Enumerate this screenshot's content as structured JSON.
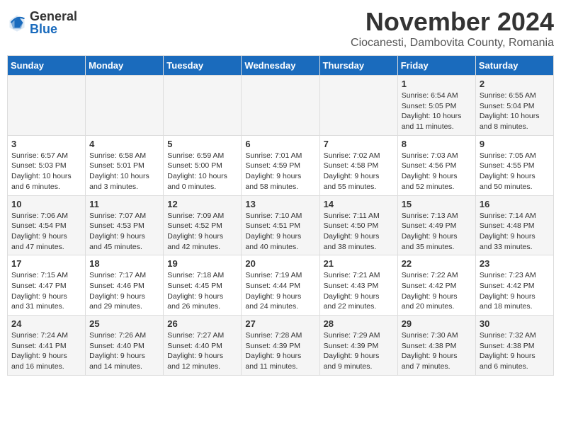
{
  "logo": {
    "general": "General",
    "blue": "Blue"
  },
  "title": {
    "month": "November 2024",
    "location": "Ciocanesti, Dambovita County, Romania"
  },
  "weekdays": [
    "Sunday",
    "Monday",
    "Tuesday",
    "Wednesday",
    "Thursday",
    "Friday",
    "Saturday"
  ],
  "weeks": [
    [
      {
        "day": "",
        "sunrise": "",
        "sunset": "",
        "daylight": ""
      },
      {
        "day": "",
        "sunrise": "",
        "sunset": "",
        "daylight": ""
      },
      {
        "day": "",
        "sunrise": "",
        "sunset": "",
        "daylight": ""
      },
      {
        "day": "",
        "sunrise": "",
        "sunset": "",
        "daylight": ""
      },
      {
        "day": "",
        "sunrise": "",
        "sunset": "",
        "daylight": ""
      },
      {
        "day": "1",
        "sunrise": "Sunrise: 6:54 AM",
        "sunset": "Sunset: 5:05 PM",
        "daylight": "Daylight: 10 hours and 11 minutes."
      },
      {
        "day": "2",
        "sunrise": "Sunrise: 6:55 AM",
        "sunset": "Sunset: 5:04 PM",
        "daylight": "Daylight: 10 hours and 8 minutes."
      }
    ],
    [
      {
        "day": "3",
        "sunrise": "Sunrise: 6:57 AM",
        "sunset": "Sunset: 5:03 PM",
        "daylight": "Daylight: 10 hours and 6 minutes."
      },
      {
        "day": "4",
        "sunrise": "Sunrise: 6:58 AM",
        "sunset": "Sunset: 5:01 PM",
        "daylight": "Daylight: 10 hours and 3 minutes."
      },
      {
        "day": "5",
        "sunrise": "Sunrise: 6:59 AM",
        "sunset": "Sunset: 5:00 PM",
        "daylight": "Daylight: 10 hours and 0 minutes."
      },
      {
        "day": "6",
        "sunrise": "Sunrise: 7:01 AM",
        "sunset": "Sunset: 4:59 PM",
        "daylight": "Daylight: 9 hours and 58 minutes."
      },
      {
        "day": "7",
        "sunrise": "Sunrise: 7:02 AM",
        "sunset": "Sunset: 4:58 PM",
        "daylight": "Daylight: 9 hours and 55 minutes."
      },
      {
        "day": "8",
        "sunrise": "Sunrise: 7:03 AM",
        "sunset": "Sunset: 4:56 PM",
        "daylight": "Daylight: 9 hours and 52 minutes."
      },
      {
        "day": "9",
        "sunrise": "Sunrise: 7:05 AM",
        "sunset": "Sunset: 4:55 PM",
        "daylight": "Daylight: 9 hours and 50 minutes."
      }
    ],
    [
      {
        "day": "10",
        "sunrise": "Sunrise: 7:06 AM",
        "sunset": "Sunset: 4:54 PM",
        "daylight": "Daylight: 9 hours and 47 minutes."
      },
      {
        "day": "11",
        "sunrise": "Sunrise: 7:07 AM",
        "sunset": "Sunset: 4:53 PM",
        "daylight": "Daylight: 9 hours and 45 minutes."
      },
      {
        "day": "12",
        "sunrise": "Sunrise: 7:09 AM",
        "sunset": "Sunset: 4:52 PM",
        "daylight": "Daylight: 9 hours and 42 minutes."
      },
      {
        "day": "13",
        "sunrise": "Sunrise: 7:10 AM",
        "sunset": "Sunset: 4:51 PM",
        "daylight": "Daylight: 9 hours and 40 minutes."
      },
      {
        "day": "14",
        "sunrise": "Sunrise: 7:11 AM",
        "sunset": "Sunset: 4:50 PM",
        "daylight": "Daylight: 9 hours and 38 minutes."
      },
      {
        "day": "15",
        "sunrise": "Sunrise: 7:13 AM",
        "sunset": "Sunset: 4:49 PM",
        "daylight": "Daylight: 9 hours and 35 minutes."
      },
      {
        "day": "16",
        "sunrise": "Sunrise: 7:14 AM",
        "sunset": "Sunset: 4:48 PM",
        "daylight": "Daylight: 9 hours and 33 minutes."
      }
    ],
    [
      {
        "day": "17",
        "sunrise": "Sunrise: 7:15 AM",
        "sunset": "Sunset: 4:47 PM",
        "daylight": "Daylight: 9 hours and 31 minutes."
      },
      {
        "day": "18",
        "sunrise": "Sunrise: 7:17 AM",
        "sunset": "Sunset: 4:46 PM",
        "daylight": "Daylight: 9 hours and 29 minutes."
      },
      {
        "day": "19",
        "sunrise": "Sunrise: 7:18 AM",
        "sunset": "Sunset: 4:45 PM",
        "daylight": "Daylight: 9 hours and 26 minutes."
      },
      {
        "day": "20",
        "sunrise": "Sunrise: 7:19 AM",
        "sunset": "Sunset: 4:44 PM",
        "daylight": "Daylight: 9 hours and 24 minutes."
      },
      {
        "day": "21",
        "sunrise": "Sunrise: 7:21 AM",
        "sunset": "Sunset: 4:43 PM",
        "daylight": "Daylight: 9 hours and 22 minutes."
      },
      {
        "day": "22",
        "sunrise": "Sunrise: 7:22 AM",
        "sunset": "Sunset: 4:42 PM",
        "daylight": "Daylight: 9 hours and 20 minutes."
      },
      {
        "day": "23",
        "sunrise": "Sunrise: 7:23 AM",
        "sunset": "Sunset: 4:42 PM",
        "daylight": "Daylight: 9 hours and 18 minutes."
      }
    ],
    [
      {
        "day": "24",
        "sunrise": "Sunrise: 7:24 AM",
        "sunset": "Sunset: 4:41 PM",
        "daylight": "Daylight: 9 hours and 16 minutes."
      },
      {
        "day": "25",
        "sunrise": "Sunrise: 7:26 AM",
        "sunset": "Sunset: 4:40 PM",
        "daylight": "Daylight: 9 hours and 14 minutes."
      },
      {
        "day": "26",
        "sunrise": "Sunrise: 7:27 AM",
        "sunset": "Sunset: 4:40 PM",
        "daylight": "Daylight: 9 hours and 12 minutes."
      },
      {
        "day": "27",
        "sunrise": "Sunrise: 7:28 AM",
        "sunset": "Sunset: 4:39 PM",
        "daylight": "Daylight: 9 hours and 11 minutes."
      },
      {
        "day": "28",
        "sunrise": "Sunrise: 7:29 AM",
        "sunset": "Sunset: 4:39 PM",
        "daylight": "Daylight: 9 hours and 9 minutes."
      },
      {
        "day": "29",
        "sunrise": "Sunrise: 7:30 AM",
        "sunset": "Sunset: 4:38 PM",
        "daylight": "Daylight: 9 hours and 7 minutes."
      },
      {
        "day": "30",
        "sunrise": "Sunrise: 7:32 AM",
        "sunset": "Sunset: 4:38 PM",
        "daylight": "Daylight: 9 hours and 6 minutes."
      }
    ]
  ]
}
